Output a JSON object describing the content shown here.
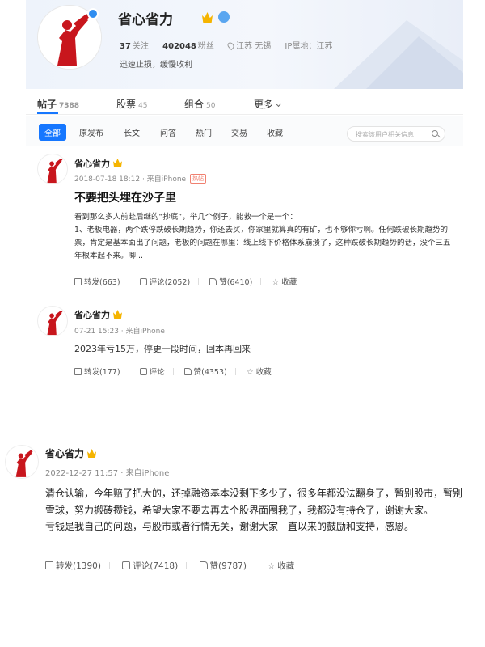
{
  "profile": {
    "name": "省心省力",
    "follow_count": "37",
    "follow_label": "关注",
    "fans_count": "402048",
    "fans_label": "粉丝",
    "location": "江苏 无锡",
    "ip_label": "IP属地：江苏",
    "bio": "迅速止损，缓慢收利"
  },
  "tabs": [
    {
      "label": "帖子",
      "count": "7388"
    },
    {
      "label": "股票",
      "count": "45"
    },
    {
      "label": "组合",
      "count": "50"
    },
    {
      "label": "更多",
      "count": ""
    }
  ],
  "filters": [
    "全部",
    "原发布",
    "长文",
    "问答",
    "热门",
    "交易",
    "收藏"
  ],
  "search": {
    "placeholder": "搜索该用户相关信息"
  },
  "posts": [
    {
      "user": "省心省力",
      "meta": "2018-07-18 18:12 · 来自iPhone",
      "tag": "热帖",
      "title": "不要把头埋在沙子里",
      "body1": "看到那么多人前赴后继的“抄底”，举几个例子，能救一个是一个：",
      "body2": "1、老板电器，两个跌停跌破长期趋势，你还去买，你家里就算真的有矿，也不够你亏啊。任何跌破长期趋势的票，肯定是基本面出了问题，老板的问题在哪里：线上线下价格体系崩溃了，这种跌破长期趋势的话，没个三五年根本起不来。唧...",
      "repost": "转发(663)",
      "comment": "评论(2052)",
      "like": "赞(6410)",
      "fav": "收藏"
    },
    {
      "user": "省心省力",
      "meta": "07-21 15:23 · 来自iPhone",
      "body1": "2023年亏15万，停更一段时间，回本再回来",
      "repost": "转发(177)",
      "comment": "评论",
      "like": "赞(4353)",
      "fav": "收藏"
    }
  ],
  "big_post": {
    "user": "省心省力",
    "meta": "2022-12-27 11:57 · 来自iPhone",
    "body1": "清仓认输，今年赔了把大的，还掉融资基本没剩下多少了，很多年都没法翻身了，暂别股市，暂别雪球，努力搬砖攒钱，希望大家不要去再去个股界面圈我了，我都没有持仓了，谢谢大家。",
    "body2": "亏钱是我自己的问题，与股市或者行情无关，谢谢大家一直以来的鼓励和支持，感恩。",
    "repost": "转发(1390)",
    "comment": "评论(7418)",
    "like": "赞(9787)",
    "fav": "收藏"
  }
}
